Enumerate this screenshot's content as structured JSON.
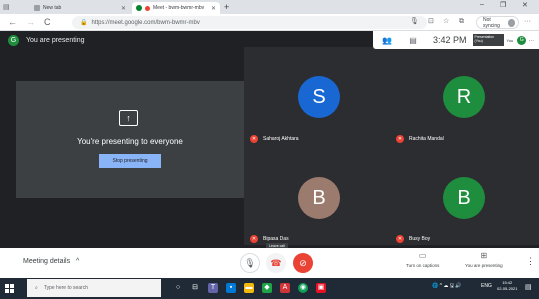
{
  "browser": {
    "tabs": [
      {
        "label": "New tab",
        "active": false
      },
      {
        "label": "Meet - bwm-bwmr-mbv",
        "active": true
      }
    ],
    "new_tab": "+",
    "window_controls": {
      "minimize": "–",
      "restore": "❐",
      "close": "✕"
    },
    "nav": {
      "back": "←",
      "forward": "→",
      "reload": "C"
    },
    "url": "https://meet.google.com/bwm-bwmr-mbv",
    "profile_label": "Not syncing",
    "menu": "···"
  },
  "meet": {
    "account_initial": "G",
    "presenting_label": "You are presenting",
    "present_message": "You're presenting to everyone",
    "stop_button": "Stop presenting",
    "time": "3:42 PM",
    "thumb_label": "Presentation (You)",
    "you_label": "You",
    "tooltip": "Leave call",
    "participants": [
      {
        "initial": "S",
        "name": "Saharoj Akhtara",
        "color": "#1967d2"
      },
      {
        "initial": "R",
        "name": "Rachita Mandal",
        "color": "#1e8e3e"
      },
      {
        "initial": "B",
        "name": "Bipasa Das",
        "color": "#9c7b6f"
      },
      {
        "initial": "B",
        "name": "Busy Boy",
        "color": "#1e8e3e"
      }
    ]
  },
  "bottom_bar": {
    "meeting_details": "Meeting details",
    "captions": "Turn on captions",
    "presenting": "You are presenting"
  },
  "taskbar": {
    "search_placeholder": "Type here to search",
    "tray_lang": "ENG",
    "clock_time": "15:42",
    "clock_date": "02-05-2021"
  }
}
